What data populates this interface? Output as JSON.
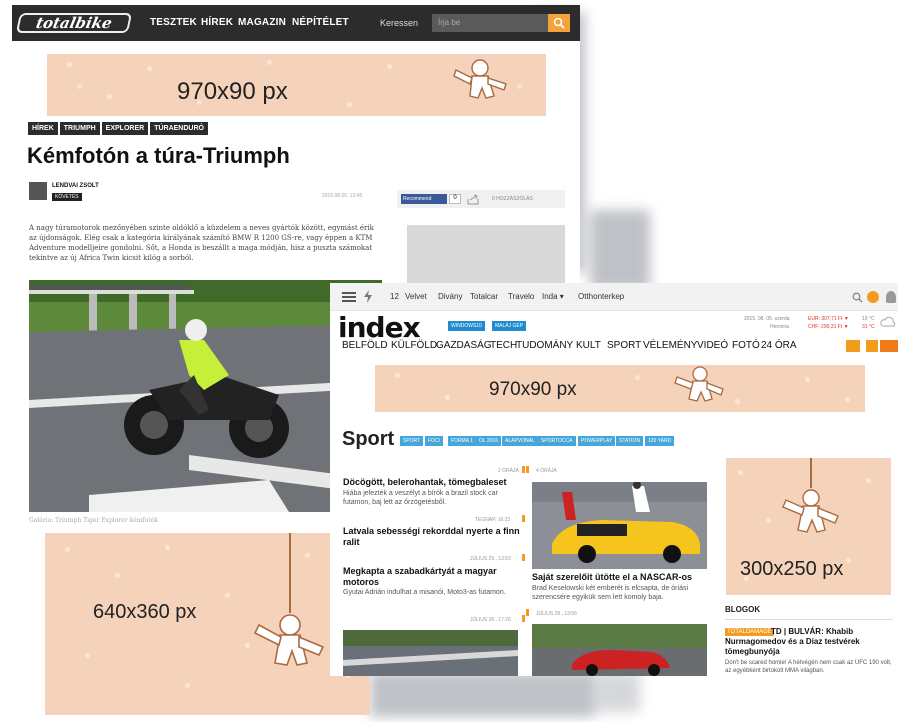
{
  "totalbike": {
    "logo": "totalbike",
    "menu": [
      "TESZTEK",
      "HÍREK",
      "MAGAZIN",
      "NÉPÍTÉLET"
    ],
    "search_label": "Keressen",
    "search_placeholder": "Írja be",
    "ad_top": "970x90 px",
    "tags": [
      "HÍREK",
      "TRIUMPH",
      "EXPLORER",
      "TÚRAENDURÓ"
    ],
    "title": "Kémfotón a túra-Triumph",
    "author": "LENDVAI ZSOLT",
    "follow": "KÖVETÉS",
    "date": "2015.08.05. 10:45",
    "fb_recommend": "Recommend",
    "fb_count": "0",
    "comments": "0 HOZZÁSZÓLÁS",
    "lead": "A nagy túramotorok mezőnyében szinte oldóklő a küzdelem a neves gyártók között, egymást érik az újdonságok. Elég csak a kategória királyának számító BMW R 1200 GS-re, vagy éppen a KTM Adventure modelljeire gondolni. Sőt, a Honda is beszállt a maga módján, hisz a puszta számokat tekintve az új Africa Twin kicsit kilóg a sorból.",
    "caption": "Galéria: Triumph Tiger Explorer kémfotók",
    "ad_bottom": "640x360 px"
  },
  "index": {
    "topbar": [
      "12",
      "Velvet",
      "Divány",
      "Totalcar",
      "Travelo",
      "Inda ▾",
      "Otthonterkep"
    ],
    "logo": "index",
    "pills": [
      "WINDOWS10",
      "MALÁJ GÉP"
    ],
    "date": "2015. 08. 05. szerda",
    "nameday": "Hermina",
    "eur": "EUR: 307,71 Ft ▼",
    "chf": "CHF: 290,31 Ft ▼",
    "temp1": "19 °C",
    "temp2": "31 °C",
    "nav": [
      "BELFÖLD",
      "KÜLFÖLD",
      "GAZDASÁG",
      "TECH",
      "TUDOMÁNY",
      "KULT",
      "SPORT",
      "VÉLEMÉNY",
      "VIDEÓ",
      "FOTÓ",
      "24 ÓRA"
    ],
    "ad_top": "970x90 px",
    "section": "Sport",
    "section_tabs": [
      "SPORT",
      "FOCI",
      "FORMA 1",
      "OL 2016",
      "ALAPVONAL",
      "SPORTOCCA",
      "POWERPLAY",
      "STATION",
      "120 YARD"
    ],
    "articles": [
      {
        "meta": "2 ÓRÁJA",
        "title": "Döcögött, belerohantak, tömegbaleset",
        "summary": "Hiába jelezték a veszélyt a bírók a brazil stock car futamon, baj lett az őrzögetésből."
      },
      {
        "meta": "TEGNAP, 16:23",
        "title": "Latvala sebességi rekorddal nyerte a finn ralit",
        "summary": ""
      },
      {
        "meta": "JÚLIUS 29., 13:53",
        "title": "Megkapta a szabadkártyát a magyar motoros",
        "summary": "Gyutai Adrián indulhat a misanói, Moto3-as futamon."
      },
      {
        "meta": "JÚLIUS 26., 17:26",
        "title": "",
        "summary": ""
      }
    ],
    "feature": {
      "meta": "4 ÓRÁJA",
      "title": "Saját szerelőit ütötte el a NASCAR-os",
      "summary": "Brad Keselowski két emberét is elcsapta, de óriási szerencsére egyikük sem lett komoly baja.",
      "meta2": "JÚLIUS 28., 13:56"
    },
    "ad_side": "300x250 px",
    "blogs_title": "BLOGOK",
    "blog_label": "TOTALDAMAGE",
    "blog_title": "TD | BULVÁR: Khabib Nurmagomedov és a Diaz testvérek tömegbunyója",
    "blog_summary": "Don't be scared homie! A hétvégén nem csak az UFC 190 volt, az egyébként birtokolt MMA világban."
  }
}
